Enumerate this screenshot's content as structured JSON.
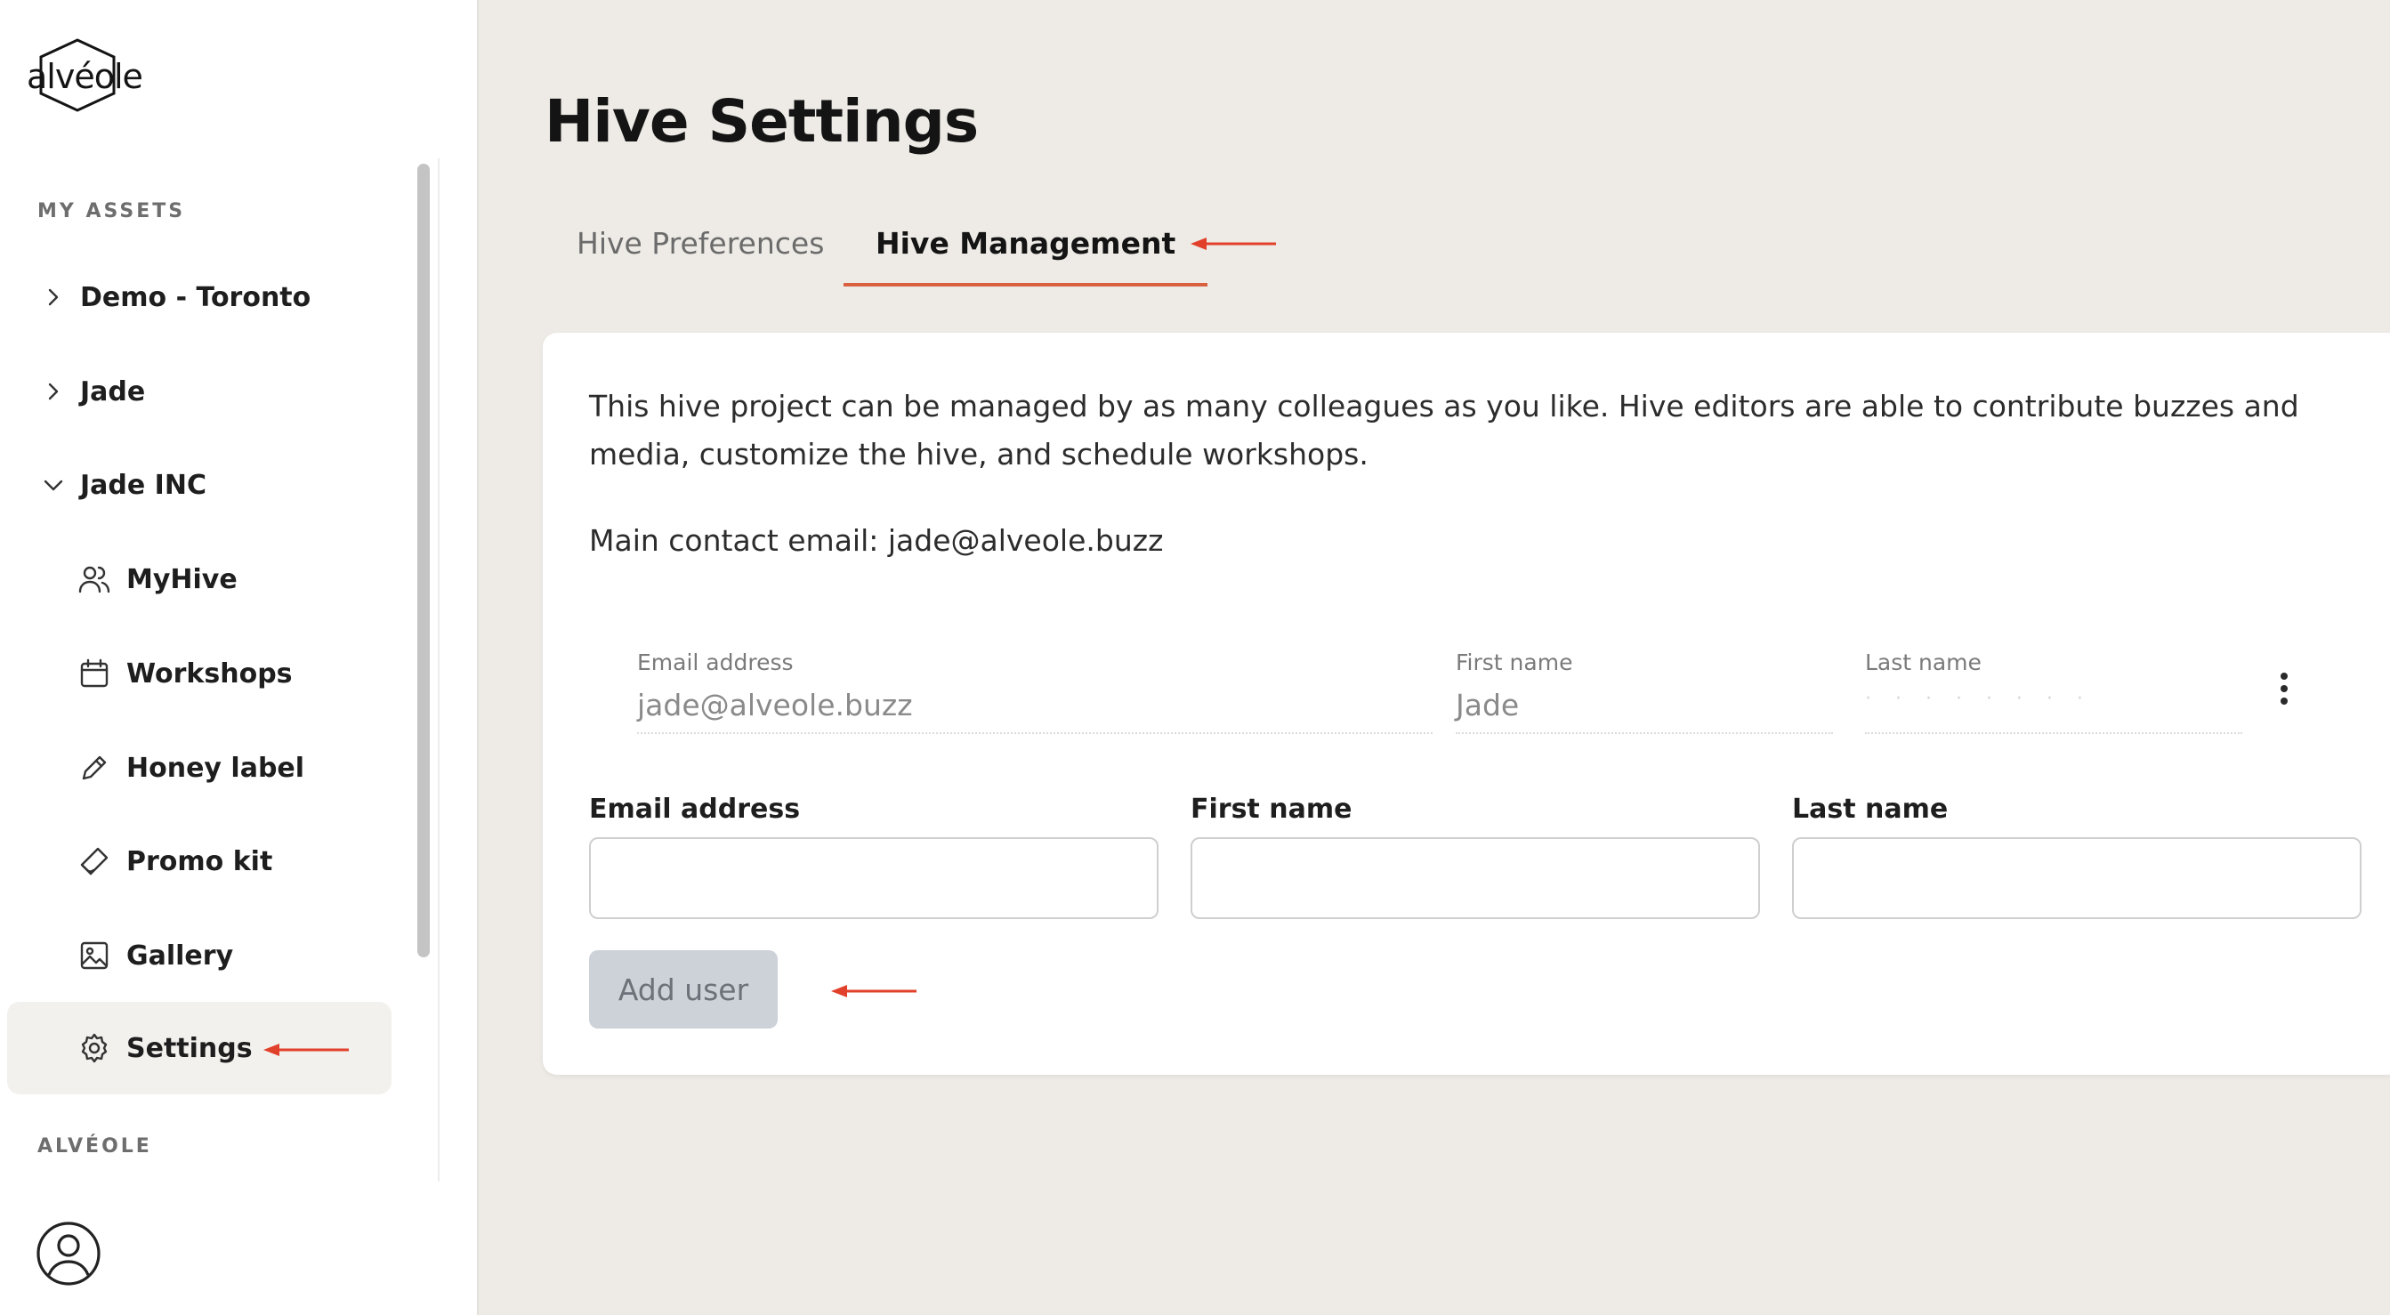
{
  "brand": {
    "logo_text": "alvéole"
  },
  "sidebar": {
    "section_my_assets": "MY ASSETS",
    "items": [
      {
        "label": "Demo - Toronto",
        "state": "collapsed"
      },
      {
        "label": "Jade",
        "state": "collapsed"
      },
      {
        "label": "Jade INC",
        "state": "expanded"
      }
    ],
    "sub_items": [
      {
        "label": "MyHive",
        "icon": "users-icon"
      },
      {
        "label": "Workshops",
        "icon": "calendar-icon"
      },
      {
        "label": "Honey label",
        "icon": "pencil-icon"
      },
      {
        "label": "Promo kit",
        "icon": "megaphone-icon"
      },
      {
        "label": "Gallery",
        "icon": "image-icon"
      },
      {
        "label": "Settings",
        "icon": "gear-icon",
        "active": true
      }
    ],
    "section_alveole": "ALVÉOLE"
  },
  "page": {
    "title": "Hive Settings"
  },
  "tabs": {
    "preferences": "Hive Preferences",
    "management": "Hive Management",
    "active": "management"
  },
  "card": {
    "description": "This hive project can be managed by as many colleagues as you like. Hive editors are able to contribute buzzes and media, customize the hive, and schedule workshops.",
    "contact": "Main contact email: jade@alveole.buzz",
    "existing_user": {
      "email_label": "Email address",
      "email_value": "jade@alveole.buzz",
      "first_label": "First name",
      "first_value": "Jade",
      "last_label": "Last name"
    },
    "form": {
      "email_label": "Email address",
      "first_label": "First name",
      "last_label": "Last name",
      "email_value": "",
      "first_value": "",
      "last_value": ""
    },
    "add_button": "Add user"
  },
  "colors": {
    "accent": "#d9603e",
    "annotation_arrow": "#e1402a",
    "background": "#eeebe6",
    "button_disabled": "#cdd1d8"
  }
}
